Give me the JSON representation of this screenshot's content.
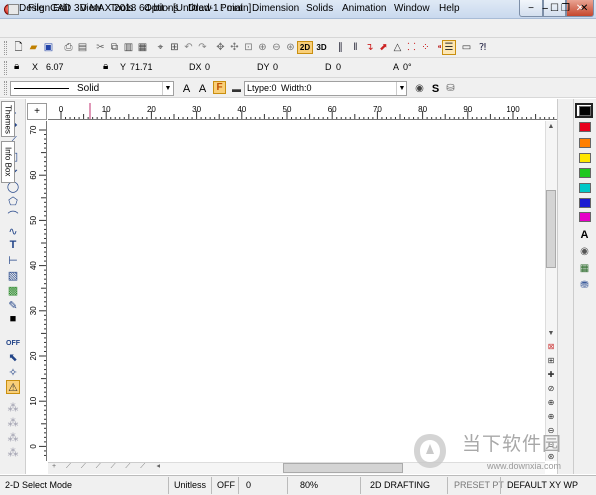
{
  "window": {
    "title": "DesignCAD 3D MAX 2018 64-bit - [Untitled-1 : main]",
    "minimize": "−",
    "maximize": "☐",
    "close": "✕"
  },
  "menu": [
    "File",
    "Edit",
    "View",
    "Tools",
    "Options",
    "Draw",
    "Point",
    "Dimension",
    "Solids",
    "Animation",
    "Window",
    "Help"
  ],
  "menu_right_controls": {
    "minimize": "−",
    "restore": "❐",
    "close": "✕"
  },
  "toolbar": {
    "view_2d": "2D",
    "view_3d": "3D"
  },
  "coords": {
    "x_label": "X",
    "x_value": "6.07",
    "y_label": "Y",
    "y_value": "71.71",
    "dx_label": "DX",
    "dx_value": "0",
    "dy_label": "DY",
    "dy_value": "0",
    "d_label": "D",
    "d_value": "0",
    "a_label": "A",
    "a_value": "0°"
  },
  "line_style": {
    "style": "Solid",
    "font_a1": "A",
    "font_a2": "A",
    "font_f": "F",
    "ltype_label": "Ltype:0",
    "width_label": "Width:0",
    "dollar": "S"
  },
  "hruler_labels": [
    "0",
    "10",
    "20",
    "30",
    "40",
    "50",
    "60",
    "70",
    "80",
    "90",
    "100"
  ],
  "vruler_labels": [
    "70",
    "60",
    "50",
    "40",
    "30",
    "20",
    "10",
    "0"
  ],
  "side_tabs": [
    "Themes",
    "Info Box"
  ],
  "colors": [
    "#000000",
    "#e8001c",
    "#ff7f00",
    "#ffe600",
    "#1ec81e",
    "#00c8c8",
    "#1a1ad2",
    "#e600c8"
  ],
  "left_tools_text": {
    "text_tool": "T",
    "off_label": "OFF"
  },
  "status": {
    "mode": "2-D Select Mode",
    "units": "Unitless",
    "off": "OFF",
    "zero": "0",
    "zoom": "80%",
    "drafting": "2D DRAFTING",
    "preset": "PRESET PT",
    "workplane": "DEFAULT XY WP"
  },
  "watermark": {
    "cn_text": "当下软件园",
    "url": "www.downxia.com"
  }
}
